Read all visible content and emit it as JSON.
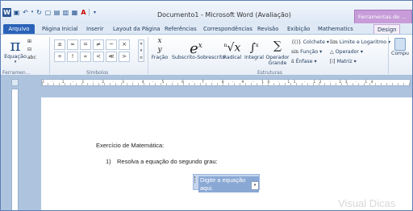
{
  "window": {
    "title": "Documento1  -  Microsoft Word (Avaliação)",
    "context_tab": "Ferramentas de ..."
  },
  "qat": {
    "icons": [
      "word-logo",
      "save-icon",
      "undo-icon",
      "redo-icon",
      "new-icon",
      "open-icon",
      "print-icon",
      "format-icon",
      "font-color-icon",
      "customize-icon"
    ]
  },
  "tabs": [
    {
      "label": "Arquivo"
    },
    {
      "label": "Página Inicial"
    },
    {
      "label": "Inserir"
    },
    {
      "label": "Layout da Página"
    },
    {
      "label": "Referências"
    },
    {
      "label": "Correspondências"
    },
    {
      "label": "Revisão"
    },
    {
      "label": "Exibição"
    },
    {
      "label": "Mathematics"
    },
    {
      "label": "Design"
    }
  ],
  "ribbon": {
    "equation_label": "Equação",
    "tools_group_label": "Ferramen...",
    "symbols_group_label": "Símbolos",
    "structures_group_label": "Estruturas",
    "symbols": [
      "±",
      "∞",
      "=",
      "≠",
      "~",
      "×",
      "÷",
      "!",
      "∝",
      "<",
      "≪",
      ">"
    ],
    "structures": [
      {
        "label": "Fração"
      },
      {
        "label": "Subscrito-Sobrescrito"
      },
      {
        "label": "Radical"
      },
      {
        "label": "Integral"
      },
      {
        "label": "Operador Grande"
      }
    ],
    "structure_rows": {
      "colchete": "Colchete",
      "funcao": "Função",
      "enfase": "Ênfase",
      "limite": "Limite e Logaritmo",
      "operador": "Operador",
      "matriz": "Matriz"
    },
    "compat_label": "Compu"
  },
  "ruler": {
    "numbers": "2 · 1 · 1 · 2 · 3 · 4 · 5 · 6 · 7 · 8 · 9 · 10 · 11 · 12 · 13 · 14"
  },
  "document": {
    "heading": "Exercício de Matemática:",
    "list_number": "1)",
    "list_text": "Resolva a equação do segundo grau:",
    "equation_placeholder": "Digite a equação aqui."
  },
  "watermark": "Visual Dicas"
}
